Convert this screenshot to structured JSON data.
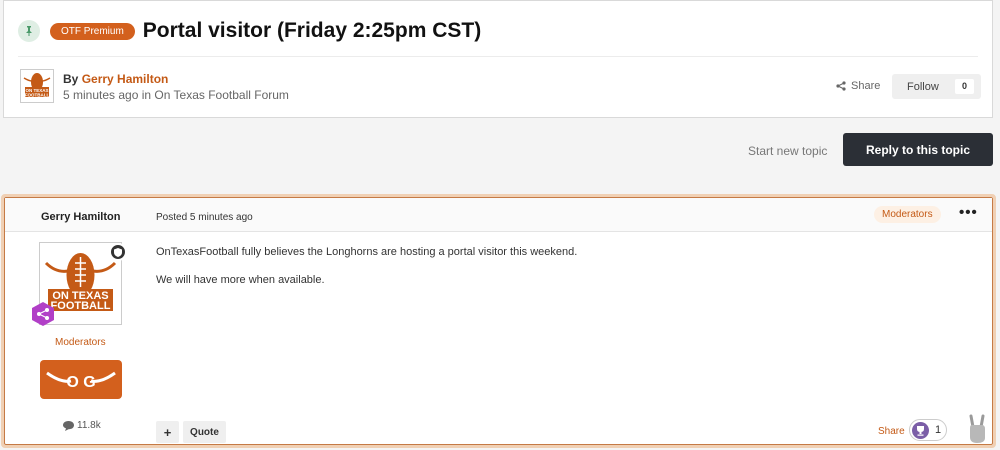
{
  "header": {
    "badge": "OTF Premium",
    "title": "Portal visitor (Friday 2:25pm CST)",
    "by_prefix": "By",
    "author": "Gerry Hamilton",
    "time": "5 minutes ago",
    "in_word": "in",
    "forum": "On Texas Football Forum",
    "share_label": "Share",
    "follow_label": "Follow",
    "follow_count": "0"
  },
  "actions": {
    "start_topic": "Start new topic",
    "reply": "Reply to this topic"
  },
  "post": {
    "author": "Gerry Hamilton",
    "posted_prefix": "Posted",
    "posted_time": "5 minutes ago",
    "group_badge": "Moderators",
    "menu": "•••",
    "rank": "Moderators",
    "reputation": "11.8k",
    "body": [
      "OnTexasFootball fully believes the Longhorns are hosting a portal visitor this weekend.",
      "We will have more when available."
    ],
    "plus_label": "+",
    "quote_label": "Quote",
    "share_label": "Share",
    "reaction_count": "1"
  },
  "logo": {
    "line1": "ON TEXAS",
    "line2": "FOOTBALL",
    "otg": "O G"
  },
  "colors": {
    "accent": "#c45a16",
    "badge_bg": "#d3601d",
    "dark_button": "#2b2f36",
    "pin_green": "#4a9a6a",
    "hex_purple": "#b13fc7"
  }
}
